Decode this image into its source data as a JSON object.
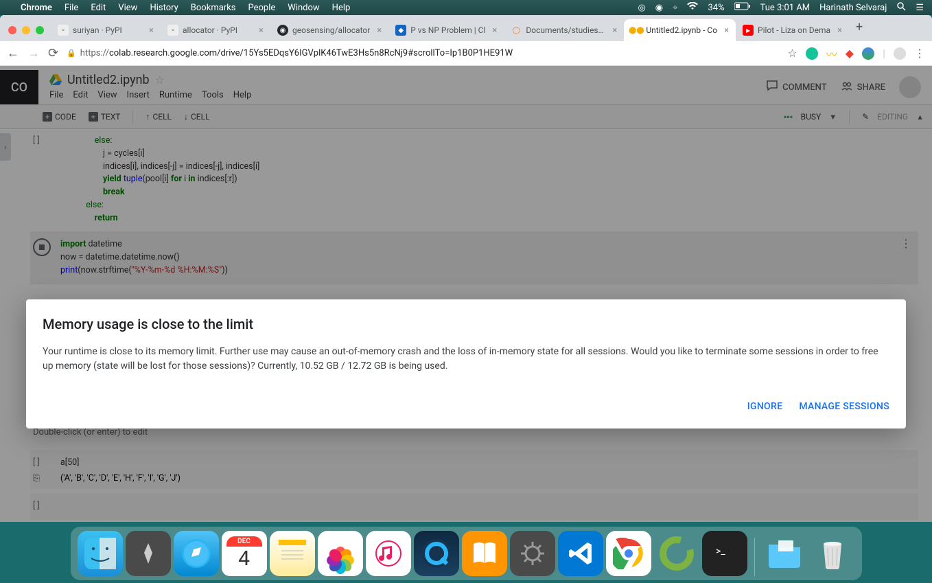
{
  "menubar": {
    "app": "Chrome",
    "items": [
      "File",
      "Edit",
      "View",
      "History",
      "Bookmarks",
      "People",
      "Window",
      "Help"
    ],
    "battery": "34%",
    "time": "Tue 3:01 AM",
    "user": "Harinath Selvaraj"
  },
  "tabs": [
    {
      "title": "suriyan · PyPI",
      "icon": "pypi"
    },
    {
      "title": "allocator · PyPI",
      "icon": "pypi"
    },
    {
      "title": "geosensing/allocator",
      "icon": "github"
    },
    {
      "title": "P vs NP Problem | Cl",
      "icon": "clay"
    },
    {
      "title": "Documents/studies/p",
      "icon": "jupyter"
    },
    {
      "title": "Untitled2.ipynb - Co",
      "icon": "colab",
      "active": true
    },
    {
      "title": "Pilot - Liza on Dema",
      "icon": "youtube"
    }
  ],
  "url": "https://colab.research.google.com/drive/15Ys5EDqsY6IGVplK46TwE3Hs5n8RcNj9#scrollTo=Ip1B0P1HE91W",
  "colab": {
    "logo": "CO",
    "filename": "Untitled2.ipynb",
    "menus": [
      "File",
      "Edit",
      "View",
      "Insert",
      "Runtime",
      "Tools",
      "Help"
    ],
    "actions": {
      "comment": "COMMENT",
      "share": "SHARE"
    },
    "toolbar": {
      "code": "CODE",
      "text": "TEXT",
      "cell_up": "CELL",
      "cell_down": "CELL",
      "busy": "BUSY",
      "editing": "EDITING"
    },
    "code1_lines": [
      {
        "indent": 16,
        "tokens": [
          {
            "t": "else",
            "c": "kw2"
          },
          {
            "t": ":",
            "c": ""
          }
        ]
      },
      {
        "indent": 20,
        "tokens": [
          {
            "t": "j = cycles[i]",
            "c": ""
          }
        ]
      },
      {
        "indent": 20,
        "tokens": [
          {
            "t": "indices[i], indices[-j] = indices[-j], indices[i]",
            "c": ""
          }
        ]
      },
      {
        "indent": 20,
        "tokens": [
          {
            "t": "yield",
            "c": "kw"
          },
          {
            "t": " ",
            "c": ""
          },
          {
            "t": "tuple",
            "c": "bi"
          },
          {
            "t": "(pool[i] ",
            "c": ""
          },
          {
            "t": "for",
            "c": "kw"
          },
          {
            "t": " i ",
            "c": ""
          },
          {
            "t": "in",
            "c": "kw"
          },
          {
            "t": " indices[:r])",
            "c": ""
          }
        ]
      },
      {
        "indent": 20,
        "tokens": [
          {
            "t": "break",
            "c": "kw"
          }
        ]
      },
      {
        "indent": 12,
        "tokens": [
          {
            "t": "else",
            "c": "kw2"
          },
          {
            "t": ":",
            "c": ""
          }
        ]
      },
      {
        "indent": 16,
        "tokens": [
          {
            "t": "return",
            "c": "kw"
          }
        ]
      }
    ],
    "code2_lines": [
      {
        "indent": 0,
        "tokens": [
          {
            "t": "import",
            "c": "kw"
          },
          {
            "t": " datetime",
            "c": ""
          }
        ]
      },
      {
        "indent": 0,
        "tokens": [
          {
            "t": "now = datetime.datetime.now()",
            "c": ""
          }
        ]
      },
      {
        "indent": 0,
        "tokens": [
          {
            "t": "print",
            "c": "bi"
          },
          {
            "t": "(now.strftime(",
            "c": ""
          },
          {
            "t": "\"%Y-%m-%d %H:%M:%S\"",
            "c": "str"
          },
          {
            "t": "))",
            "c": ""
          }
        ]
      }
    ],
    "text_hint": "Double-click (or enter) to edit",
    "code3": "a[50]",
    "output3": "('A', 'B', 'C', 'D', 'E', 'H', 'F', 'I', 'G', 'J')"
  },
  "modal": {
    "title": "Memory usage is close to the limit",
    "body": "Your runtime is close to its memory limit. Further use may cause an out-of-memory crash and the loss of in-memory state for all sessions. Would you like to terminate some sessions in order to free up memory (state will be lost for those sessions)? Currently, 10.52 GB / 12.72 GB is being used.",
    "ignore": "IGNORE",
    "manage": "MANAGE SESSIONS"
  },
  "dock": {
    "cal_month": "DEC",
    "cal_day": "4"
  }
}
